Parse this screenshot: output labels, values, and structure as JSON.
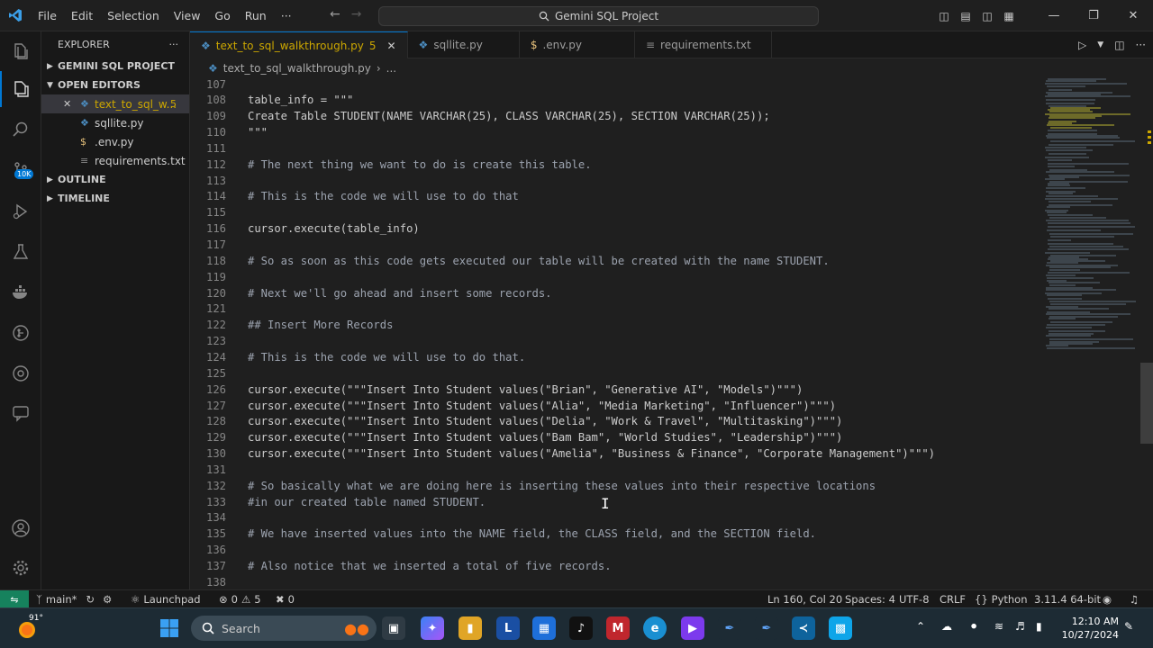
{
  "titlebar": {
    "menu": [
      "File",
      "Edit",
      "Selection",
      "View",
      "Go",
      "Run",
      "···"
    ],
    "search_text": "Gemini SQL Project"
  },
  "activitybar": {
    "source_control_badge": "10K"
  },
  "sidebar": {
    "title": "EXPLORER",
    "sections": {
      "project": "GEMINI SQL PROJECT",
      "open_editors": "OPEN EDITORS",
      "outline": "OUTLINE",
      "timeline": "TIMELINE"
    },
    "open_editors": [
      {
        "name": "text_to_sql_w...",
        "count": "5",
        "icon": "$"
      },
      {
        "name": "sqllite.py",
        "count": "",
        "icon": "$"
      },
      {
        "name": ".env.py",
        "count": "",
        "icon": "$"
      },
      {
        "name": "requirements.txt",
        "count": "",
        "icon": "$"
      }
    ]
  },
  "tabs": [
    {
      "label": "text_to_sql_walkthrough.py",
      "count": "5"
    },
    {
      "label": "sqllite.py"
    },
    {
      "label": ".env.py"
    },
    {
      "label": "requirements.txt"
    }
  ],
  "breadcrumb": {
    "file": "text_to_sql_walkthrough.py",
    "more": "..."
  },
  "editor": {
    "lines": [
      {
        "n": "107",
        "text": ""
      },
      {
        "n": "108",
        "text": "table_info = \"\"\""
      },
      {
        "n": "109",
        "text": "Create Table STUDENT(NAME VARCHAR(25), CLASS VARCHAR(25), SECTION VARCHAR(25));"
      },
      {
        "n": "110",
        "text": "\"\"\""
      },
      {
        "n": "111",
        "text": ""
      },
      {
        "n": "112",
        "text": "# The next thing we want to do is create this table."
      },
      {
        "n": "113",
        "text": ""
      },
      {
        "n": "114",
        "text": "# This is the code we will use to do that"
      },
      {
        "n": "115",
        "text": ""
      },
      {
        "n": "116",
        "text": "cursor.execute(table_info)"
      },
      {
        "n": "117",
        "text": ""
      },
      {
        "n": "118",
        "text": "# So as soon as this code gets executed our table will be created with the name STUDENT."
      },
      {
        "n": "119",
        "text": ""
      },
      {
        "n": "120",
        "text": "# Next we'll go ahead and insert some records."
      },
      {
        "n": "121",
        "text": ""
      },
      {
        "n": "122",
        "text": "## Insert More Records"
      },
      {
        "n": "123",
        "text": ""
      },
      {
        "n": "124",
        "text": "# This is the code we will use to do that."
      },
      {
        "n": "125",
        "text": ""
      },
      {
        "n": "126",
        "text": "cursor.execute(\"\"\"Insert Into Student values(\"Brian\", \"Generative AI\", \"Models\")\"\"\")"
      },
      {
        "n": "127",
        "text": "cursor.execute(\"\"\"Insert Into Student values(\"Alia\", \"Media Marketing\", \"Influencer\")\"\"\")"
      },
      {
        "n": "128",
        "text": "cursor.execute(\"\"\"Insert Into Student values(\"Delia\", \"Work & Travel\", \"Multitasking\")\"\"\")"
      },
      {
        "n": "129",
        "text": "cursor.execute(\"\"\"Insert Into Student values(\"Bam Bam\", \"World Studies\", \"Leadership\")\"\"\")"
      },
      {
        "n": "130",
        "text": "cursor.execute(\"\"\"Insert Into Student values(\"Amelia\", \"Business & Finance\", \"Corporate Management\")\"\"\")"
      },
      {
        "n": "131",
        "text": ""
      },
      {
        "n": "132",
        "text": "# So basically what we are doing here is inserting these values into their respective locations"
      },
      {
        "n": "133",
        "text": "#in our created table named STUDENT."
      },
      {
        "n": "134",
        "text": ""
      },
      {
        "n": "135",
        "text": "# We have inserted values into the NAME field, the CLASS field, and the SECTION field."
      },
      {
        "n": "136",
        "text": ""
      },
      {
        "n": "137",
        "text": "# Also notice that we inserted a total of five records."
      },
      {
        "n": "138",
        "text": ""
      }
    ]
  },
  "statusbar": {
    "branch": "main*",
    "launchpad": "Launchpad",
    "errors": "0",
    "warnings": "5",
    "ports": "0",
    "position": "Ln 160, Col 20",
    "spaces": "Spaces: 4",
    "encoding": "UTF-8",
    "eol": "CRLF",
    "language": "Python",
    "interpreter": "3.11.4 64-bit"
  },
  "taskbar": {
    "weather": "91°",
    "search_placeholder": "Search",
    "time": "12:10 AM",
    "date": "10/27/2024"
  },
  "colors": {
    "accent": "#0078d4",
    "warning": "#cca700",
    "remote": "#16825d"
  }
}
